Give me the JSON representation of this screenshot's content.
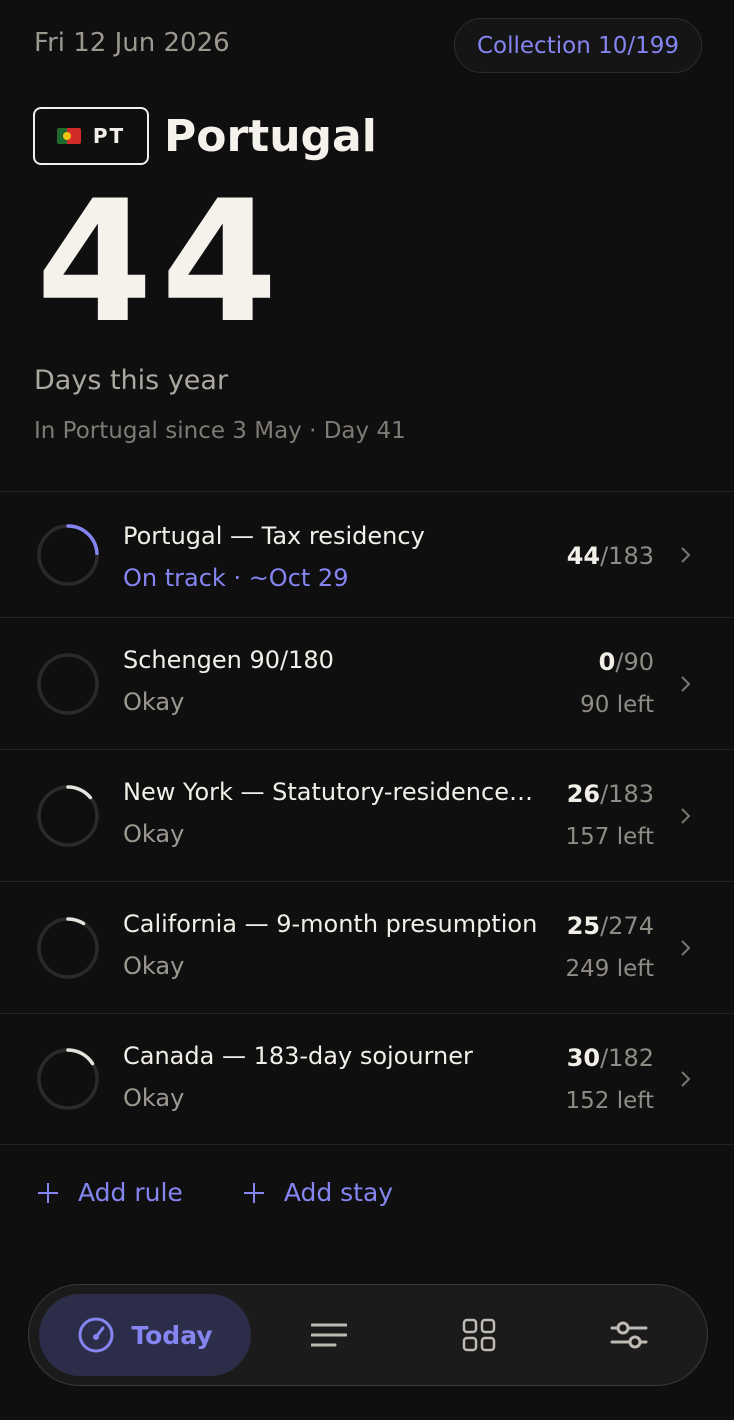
{
  "header": {
    "date": "Fri 12 Jun 2026",
    "collection_label": "Collection 10/199"
  },
  "country": {
    "code": "PT",
    "name": "Portugal",
    "days_count": "44",
    "days_label": "Days this year",
    "since_text": "In Portugal since 3 May · Day 41"
  },
  "rules": [
    {
      "title": "Portugal — Tax residency",
      "status": "On track · ~Oct 29",
      "used": "44",
      "limit": "/183",
      "left": "",
      "progress": 0.24
    },
    {
      "title": "Schengen 90/180",
      "status": "Okay",
      "used": "0",
      "limit": "/90",
      "left": "90 left",
      "progress": 0.0
    },
    {
      "title": "New York — Statutory-residence test",
      "status": "Okay",
      "used": "26",
      "limit": "/183",
      "left": "157 left",
      "progress": 0.14
    },
    {
      "title": "California — 9-month presumption",
      "status": "Okay",
      "used": "25",
      "limit": "/274",
      "left": "249 left",
      "progress": 0.09
    },
    {
      "title": "Canada — 183-day sojourner",
      "status": "Okay",
      "used": "30",
      "limit": "/182",
      "left": "152 left",
      "progress": 0.16
    }
  ],
  "actions": {
    "add_rule": "Add rule",
    "add_stay": "Add stay"
  },
  "tabbar": {
    "today_label": "Today",
    "icons": [
      "gauge-icon",
      "list-icon",
      "grid-icon",
      "sliders-icon"
    ]
  },
  "colors": {
    "background": "#0f0f0f",
    "accent": "#8585f2",
    "text": "#f2efe9",
    "muted": "#9c9891",
    "ring_track": "#2a2a2a",
    "ring_neutral": "#e6e3dd"
  }
}
